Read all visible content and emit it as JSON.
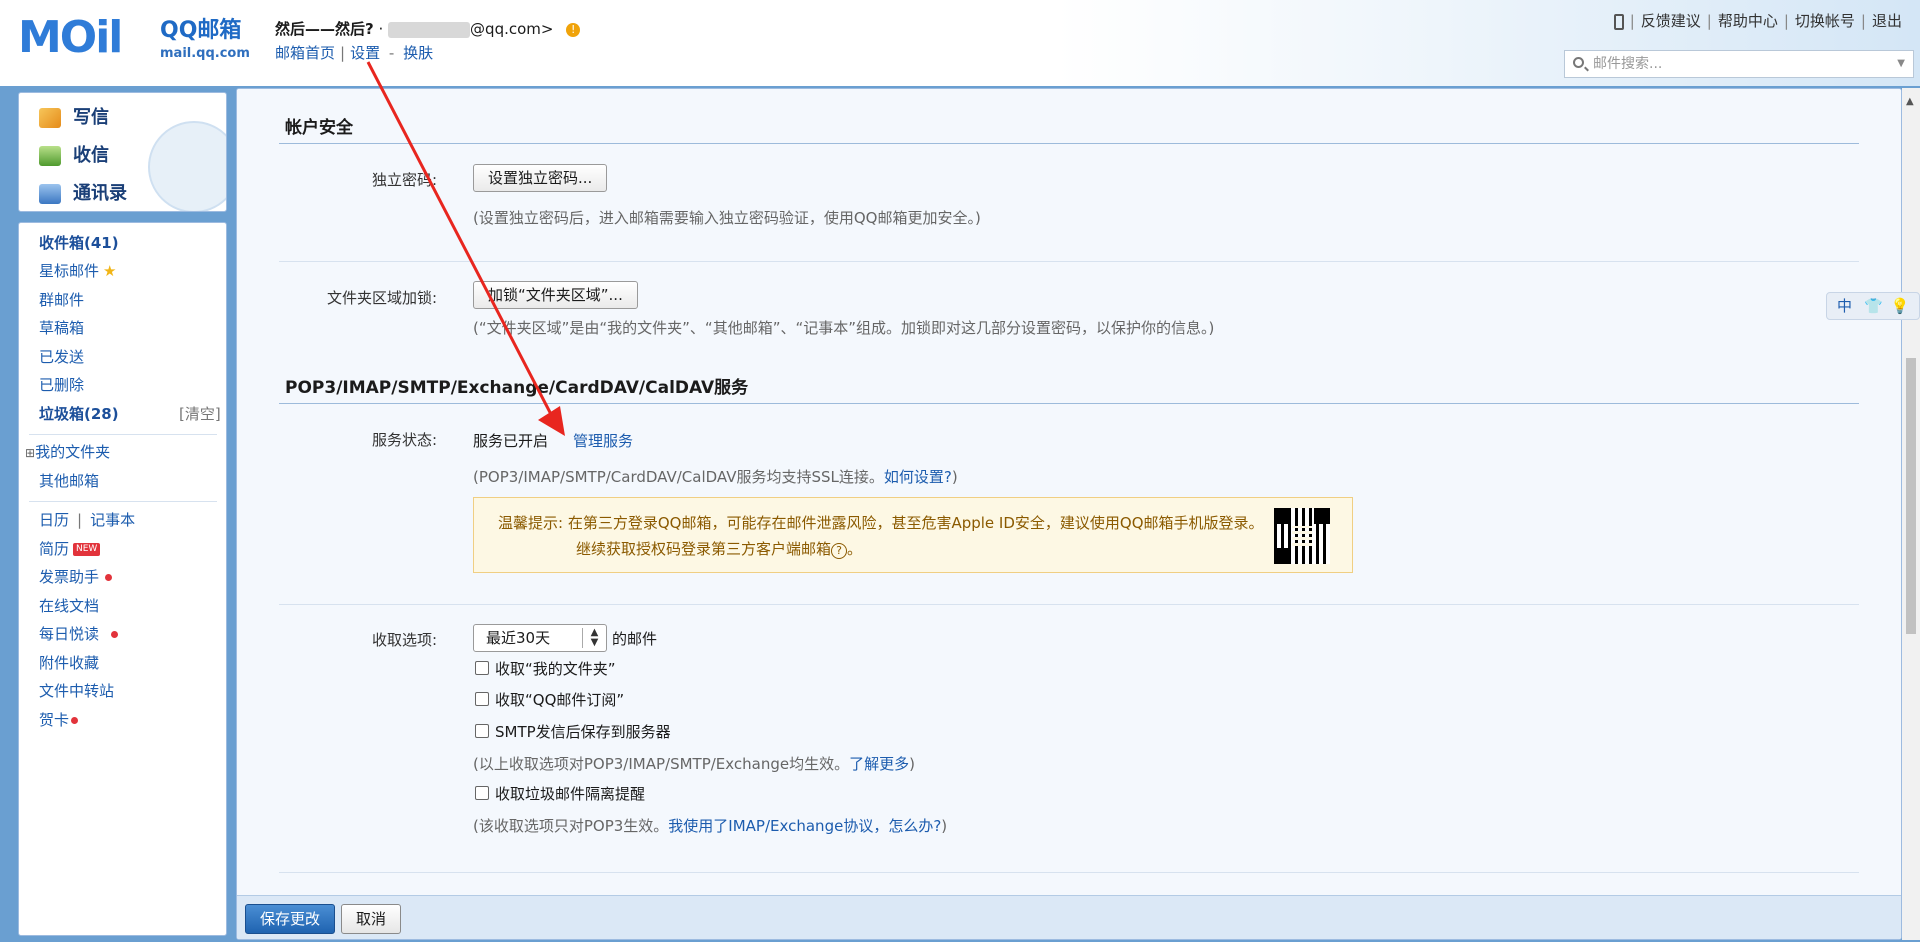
{
  "logo": {
    "mark": "MOil",
    "name": "QQ邮箱",
    "domain": "mail.qq.com"
  },
  "user": {
    "nickname": "然后——然后?",
    "email_prefix": "·",
    "email_suffix": "@qq.com>"
  },
  "top_links": {
    "home": "邮箱首页",
    "settings": "设置",
    "sep": "-",
    "skin": "换肤"
  },
  "right_links": [
    "反馈建议",
    "帮助中心",
    "切换帐号",
    "退出"
  ],
  "search": {
    "placeholder": "邮件搜索..."
  },
  "compose": {
    "write": "写信",
    "receive": "收信",
    "contacts": "通讯录"
  },
  "folders": {
    "inbox": "收件箱",
    "inbox_count": "(41)",
    "starred": "星标邮件",
    "group": "群邮件",
    "drafts": "草稿箱",
    "sent": "已发送",
    "deleted": "已删除",
    "spam": "垃圾箱",
    "spam_count": "(28)",
    "spam_clear": "[清空]",
    "my_folders": "我的文件夹",
    "other_mailboxes": "其他邮箱",
    "calendar": "日历",
    "notes": "记事本",
    "resume": "简历",
    "new_badge": "NEW",
    "invoice": "发票助手",
    "docs": "在线文档",
    "daily": "每日悦读",
    "attachments": "附件收藏",
    "transfer": "文件中转站",
    "cards": "贺卡"
  },
  "account_security": {
    "title": "帐户安全",
    "pwd_label": "独立密码:",
    "pwd_button": "设置独立密码...",
    "pwd_hint": "(设置独立密码后，进入邮箱需要输入独立密码验证，使用QQ邮箱更加安全。)",
    "lock_label": "文件夹区域加锁:",
    "lock_button": "加锁“文件夹区域”...",
    "lock_hint": "(“文件夹区域”是由“我的文件夹”、“其他邮箱”、“记事本”组成。加锁即对这几部分设置密码，以保护你的信息。)"
  },
  "pop3": {
    "title": "POP3/IMAP/SMTP/Exchange/CardDAV/CalDAV服务",
    "status_label": "服务状态:",
    "status_value": "服务已开启",
    "manage_link": "管理服务",
    "ssl_hint_prefix": "(POP3/IMAP/SMTP/CardDAV/CalDAV服务均支持SSL连接。",
    "ssl_hint_link": "如何设置?",
    "ssl_hint_suffix": ")",
    "tip_label": "温馨提示:",
    "tip_line1": "在第三方登录QQ邮箱，可能存在邮件泄露风险，甚至危害Apple ID安全，建议使用QQ邮箱手机版登录。",
    "tip_line2": "继续获取授权码登录第三方客户端邮箱",
    "tip_q": "?",
    "tip_end": "。"
  },
  "receive_options": {
    "label": "收取选项:",
    "select_value": "最近30天",
    "select_suffix": "的邮件",
    "opt1": "收取“我的文件夹”",
    "opt2": "收取“QQ邮件订阅”",
    "opt3": "SMTP发信后保存到服务器",
    "hint1_prefix": "(以上收取选项对POP3/IMAP/SMTP/Exchange均生效。",
    "hint1_link": "了解更多",
    "hint1_suffix": ")",
    "opt4": "收取垃圾邮件隔离提醒",
    "hint2_prefix": "(该收取选项只对POP3生效。",
    "hint2_link": "我使用了IMAP/Exchange协议，怎么办?",
    "hint2_suffix": ")"
  },
  "bottom": {
    "save": "保存更改",
    "cancel": "取消"
  },
  "ime": {
    "lang": "中"
  },
  "colors": {
    "accent": "#1c5cae",
    "annotation_arrow": "#e8261f",
    "tip_bg": "#fdf8e4"
  }
}
